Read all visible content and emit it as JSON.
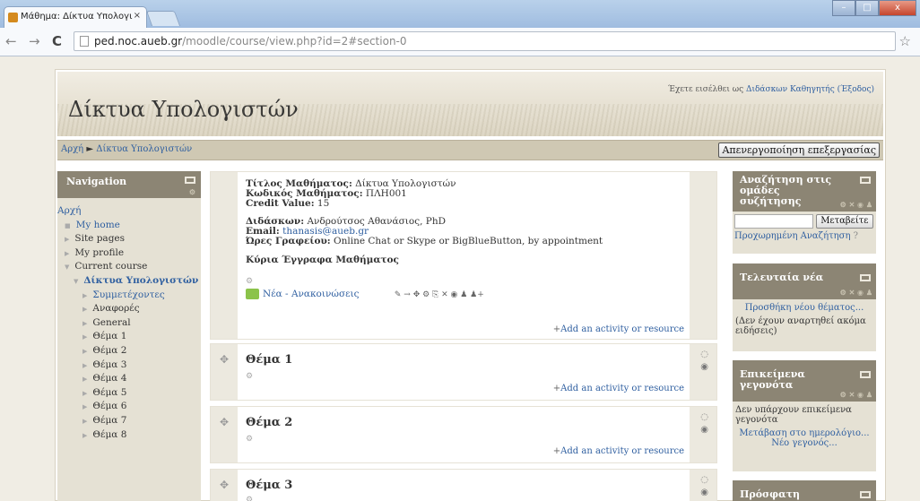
{
  "browser": {
    "tab_title": "Μάθημα: Δίκτυα Υπολογι",
    "url_host": "ped.noc.aueb.gr",
    "url_path": "/moodle/course/view.php?id=2#section-0",
    "back": "←",
    "forward": "→",
    "reload": "C",
    "star": "☆",
    "min": "–",
    "max": "□",
    "close": "x"
  },
  "header": {
    "site_title": "Δίκτυα Υπολογιστών",
    "login_prefix": "Έχετε εισέλθει ως ",
    "login_user": "Διδάσκων Καθηγητής",
    "login_logout": "(Έξοδος)"
  },
  "navbar": {
    "crumb_home": "Αρχή",
    "crumb_sep": "►",
    "crumb_course": "Δίκτυα Υπολογιστών",
    "edit_button": "Απενεργοποίηση επεξεργασίας"
  },
  "navigation": {
    "title": "Navigation",
    "items": [
      "Αρχή",
      "My home",
      "Site pages",
      "My profile",
      "Current course",
      "Δίκτυα Υπολογιστών",
      "Συμμετέχοντες",
      "Αναφορές",
      "General",
      "Θέμα 1",
      "Θέμα 2",
      "Θέμα 3",
      "Θέμα 4",
      "Θέμα 5",
      "Θέμα 6",
      "Θέμα 7",
      "Θέμα 8"
    ]
  },
  "summary": {
    "title_label": "Τίτλος Μαθήματος:",
    "title_value": "Δίκτυα Υπολογιστών",
    "code_label": "Κωδικός Μαθήματος:",
    "code_value": "ΠΛΗ001",
    "credit_label": "Credit Value:",
    "credit_value": "15",
    "teacher_label": "Διδάσκων:",
    "teacher_value": "Ανδρούτσος Αθανάσιος, PhD",
    "email_label": "Email:",
    "email_value": "thanasis@aueb.gr",
    "hours_label": "Ώρες Γραφείου:",
    "hours_value": "Online Chat or Skype or BigBlueButton, by appointment",
    "docs_heading": "Κύρια Έγγραφα Μαθήματος",
    "forum_link": "Νέα - Ανακοινώσεις",
    "edit_icons": "✎ → ✥ ⚙ ⎘ ✕ ◉ ♟ ♟+"
  },
  "sections": [
    {
      "title": "Θέμα 1"
    },
    {
      "title": "Θέμα 2"
    },
    {
      "title": "Θέμα 3"
    }
  ],
  "add_activity": "Add an activity or resource",
  "blocks": {
    "search": {
      "title": "Αναζήτηση στις ομάδες συζήτησης",
      "button": "Μεταβείτε",
      "advanced": "Προχωρημένη Αναζήτηση"
    },
    "news": {
      "title": "Τελευταία νέα",
      "add": "Προσθήκη νέου θέματος...",
      "empty": "(Δεν έχουν αναρτηθεί ακόμα ειδήσεις)"
    },
    "events": {
      "title": "Επικείμενα γεγονότα",
      "empty": "Δεν υπάρχουν επικείμενα γεγονότα",
      "calendar": "Μετάβαση στο ημερολόγιο...",
      "new_event": "Νέο γεγονός..."
    },
    "recent": {
      "title": "Πρόσφατη"
    }
  },
  "block_tools": "⚙ ✕ ◉ ♟"
}
